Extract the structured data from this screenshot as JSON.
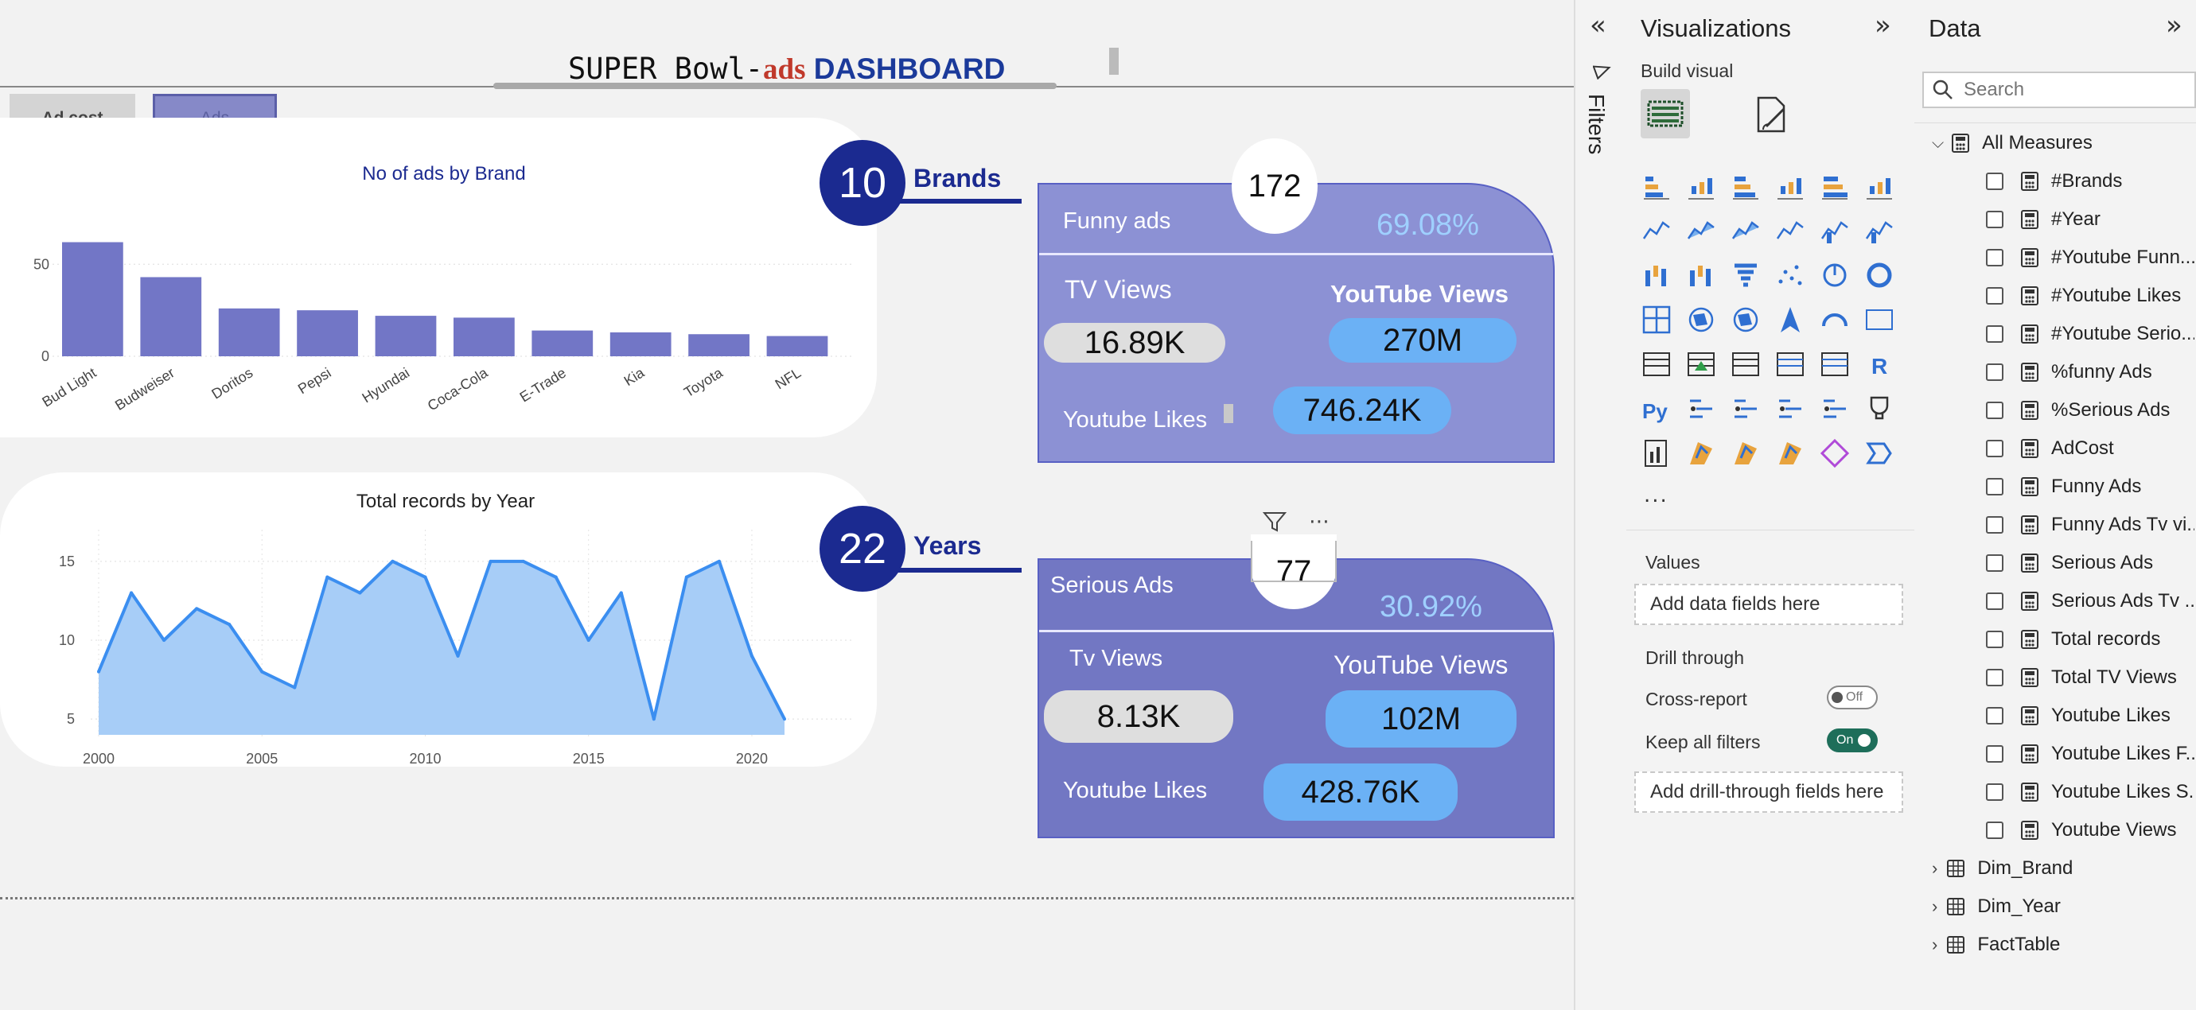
{
  "dashboard": {
    "title_part1": "SUPER Bowl-",
    "title_part2": "ads",
    "title_part3": " DASHBOARD",
    "buttons": {
      "ad_cost": "Ad cost",
      "ads": "Ads"
    }
  },
  "charts": {
    "brands_title": "No of ads by Brand",
    "years_title": "Total records by Year"
  },
  "chart_data": [
    {
      "type": "bar",
      "title": "No of ads by Brand",
      "categories": [
        "Bud Light",
        "Budweiser",
        "Doritos",
        "Pepsi",
        "Hyundai",
        "Coca-Cola",
        "E-Trade",
        "Kia",
        "Toyota",
        "NFL"
      ],
      "values": [
        62,
        43,
        26,
        25,
        22,
        21,
        14,
        13,
        12,
        11
      ],
      "yticks": [
        0,
        50
      ],
      "ylim": [
        0,
        70
      ],
      "color": "#7276c6",
      "grid": true
    },
    {
      "type": "area",
      "title": "Total records by Year",
      "x": [
        2000,
        2001,
        2002,
        2003,
        2004,
        2005,
        2006,
        2007,
        2008,
        2009,
        2010,
        2011,
        2012,
        2013,
        2014,
        2015,
        2016,
        2017,
        2018,
        2019,
        2020,
        2021
      ],
      "values": [
        8,
        13,
        10,
        12,
        11,
        8,
        7,
        14,
        13,
        15,
        14,
        9,
        15,
        15,
        14,
        10,
        13,
        5,
        14,
        15,
        9,
        5
      ],
      "xticks": [
        2000,
        2005,
        2010,
        2015,
        2020
      ],
      "yticks": [
        5,
        10,
        15
      ],
      "ylim": [
        4,
        16
      ],
      "line_color": "#3b8ef0",
      "fill_color": "#a7cdf7",
      "grid": true
    }
  ],
  "kpis": {
    "brands_count": "10",
    "brands_label": "Brands",
    "years_count": "22",
    "years_label": "Years",
    "funny": {
      "count": "172",
      "label": "Funny ads",
      "pct": "69.08%",
      "tv_label": "TV Views",
      "tv_value": "16.89K",
      "yt_label": "YouTube Views",
      "yt_value": "270M",
      "likes_label": "Youtube Likes",
      "likes_value": "746.24K"
    },
    "serious": {
      "count": "77",
      "label": "Serious Ads",
      "pct": "30.92%",
      "tv_label": "Tv Views",
      "tv_value": "8.13K",
      "yt_label": "YouTube Views",
      "yt_value": "102M",
      "likes_label": "Youtube Likes",
      "likes_value": "428.76K"
    }
  },
  "filters_pane": {
    "label": "Filters"
  },
  "visualizations": {
    "title": "Visualizations",
    "build_visual": "Build visual",
    "more": "...",
    "values_label": "Values",
    "add_data": "Add data fields here",
    "drill_through": "Drill through",
    "cross_report": "Cross-report",
    "cross_report_state": "Off",
    "keep_filters": "Keep all filters",
    "keep_filters_state": "On",
    "add_drill": "Add drill-through fields here"
  },
  "data_pane": {
    "title": "Data",
    "search_placeholder": "Search",
    "all_measures": "All Measures",
    "measures": [
      "#Brands",
      "#Year",
      "#Youtube Funn...",
      "#Youtube Likes",
      "#Youtube Serio...",
      "%funny Ads",
      "%Serious Ads",
      "AdCost",
      "Funny Ads",
      "Funny Ads Tv vi...",
      "Serious Ads",
      "Serious Ads Tv ...",
      "Total records",
      "Total TV Views",
      "Youtube Likes",
      "Youtube Likes F...",
      "Youtube Likes S...",
      "Youtube Views"
    ],
    "tables": [
      "Dim_Brand",
      "Dim_Year",
      "FactTable"
    ]
  }
}
